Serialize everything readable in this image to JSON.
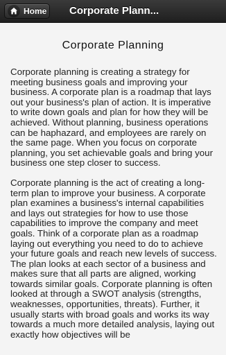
{
  "header": {
    "home_label": "Home",
    "title": "Corporate Plann..."
  },
  "main": {
    "title": "Corporate Planning",
    "paragraphs": [
      "Corporate planning is creating a strategy for meeting business goals and improving your business. A corporate plan is a roadmap that lays out your business's plan of action. It is imperative to write down goals and plan for how they will be achieved. Without planning, business operations can be haphazard, and employees are rarely on the same page. When you focus on corporate planning, you set achievable goals and bring your business one step closer to success.",
      "Corporate planning is the act of creating a long-term plan to improve your business. A corporate plan examines a business's internal capabilities and lays out strategies for how to use those capabilities to improve the company and meet goals. Think of a corporate plan as a roadmap laying out everything you need to do to achieve your future goals and reach new levels of success. The plan looks at each sector of a business and makes sure that all parts are aligned, working towards similar goals. Corporate planning is often looked at through a SWOT analysis (strengths, weaknesses, opportunities, threats). Further, it usually starts with broad goals and works its way towards a much more detailed analysis, laying out exactly how objectives will be"
    ]
  },
  "icons": {
    "home": "home-icon"
  }
}
